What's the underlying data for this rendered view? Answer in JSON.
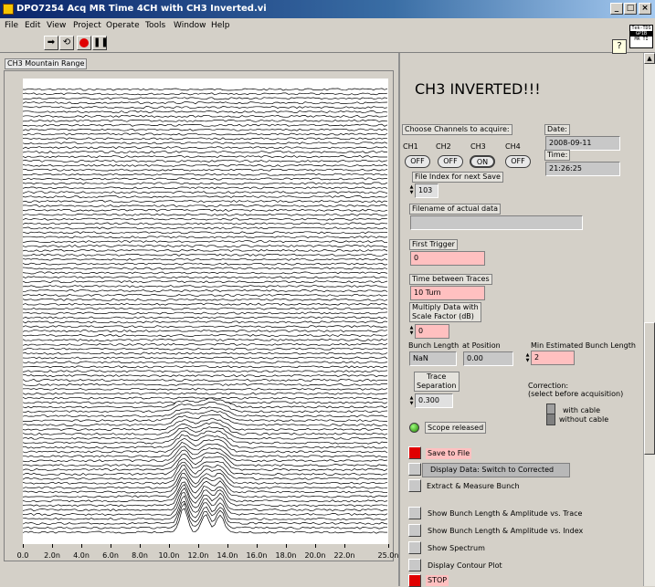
{
  "window": {
    "title": "DPO7254 Acq MR Time 4CH with CH3 Inverted.vi"
  },
  "menu": [
    "File",
    "Edit",
    "View",
    "Project",
    "Operate",
    "Tools",
    "Window",
    "Help"
  ],
  "toolbar": {
    "run": "run-arrow-icon",
    "run_continuous": "run-continuously-icon",
    "abort": "abort-icon",
    "pause": "pause-icon"
  },
  "vi_icon_text": [
    "Tek-TDS",
    "GPIB",
    "MR TI"
  ],
  "graph": {
    "label": "CH3 Mountain Range",
    "x_ticks": [
      "0.0",
      "2.0n",
      "4.0n",
      "6.0n",
      "8.0n",
      "10.0n",
      "12.0n",
      "14.0n",
      "16.0n",
      "18.0n",
      "20.0n",
      "22.0n",
      "25.0n"
    ]
  },
  "chart_data": {
    "type": "line",
    "title": "CH3 Mountain Range",
    "x_ticks": [
      "0.0",
      "2.0n",
      "4.0n",
      "6.0n",
      "8.0n",
      "10.0n",
      "12.0n",
      "14.0n",
      "16.0n",
      "18.0n",
      "20.0n",
      "22.0n",
      "25.0n"
    ],
    "xlim": [
      0,
      25
    ],
    "trace_count": 100,
    "peak_positions_ns": [
      11.0,
      12.5,
      13.5
    ],
    "style": "stacked waterfall traces, white background, black lines"
  },
  "panel": {
    "big_title": "CH3 INVERTED!!!",
    "choose_channels": "Choose Channels to acquire:",
    "channels": [
      {
        "name": "CH1",
        "state": "OFF"
      },
      {
        "name": "CH2",
        "state": "OFF"
      },
      {
        "name": "CH3",
        "state": "ON"
      },
      {
        "name": "CH4",
        "state": "OFF"
      }
    ],
    "date_label": "Date:",
    "date_value": "2008-09-11",
    "time_label": "Time:",
    "time_value": "21:26:25",
    "file_index_label": "File Index for next Save",
    "file_index_value": "103",
    "filename_label": "Filename of actual data",
    "filename_value": "",
    "first_trigger_label": "First Trigger",
    "first_trigger_value": "0",
    "time_between_label": "Time between Traces",
    "time_between_value": "10 Turn",
    "multiply_label_1": "Multiply Data with",
    "multiply_label_2": "Scale Factor (dB)",
    "multiply_value": "0",
    "bunch_length_label": "Bunch Length",
    "bunch_length_value": "NaN",
    "at_position_label": "at Position",
    "at_position_value": "0.00",
    "min_est_label": "Min Estimated Bunch Length",
    "min_est_value": "2",
    "trace_sep_label_1": "Trace",
    "trace_sep_label_2": "Separation",
    "trace_sep_value": "0.300",
    "correction_label_1": "Correction:",
    "correction_label_2": "(select before acquisition)",
    "with_cable": "with cable",
    "without_cable": "without cable",
    "scope_status": "Scope released",
    "save_to_file": "Save to File",
    "display_data": "Display Data: Switch to Corrected",
    "extract_measure": "Extract & Measure Bunch",
    "show_bunch_trace": "Show Bunch Length & Amplitude vs. Trace",
    "show_bunch_index": "Show Bunch Length & Amplitude vs. Index",
    "show_spectrum": "Show Spectrum",
    "display_contour": "Display Contour Plot",
    "stop": "STOP"
  },
  "colors": {
    "led_on": "#2a9a10",
    "button_red": "#e00000",
    "pink_field": "#ffc0c0",
    "titlebar": "#0a246a"
  }
}
